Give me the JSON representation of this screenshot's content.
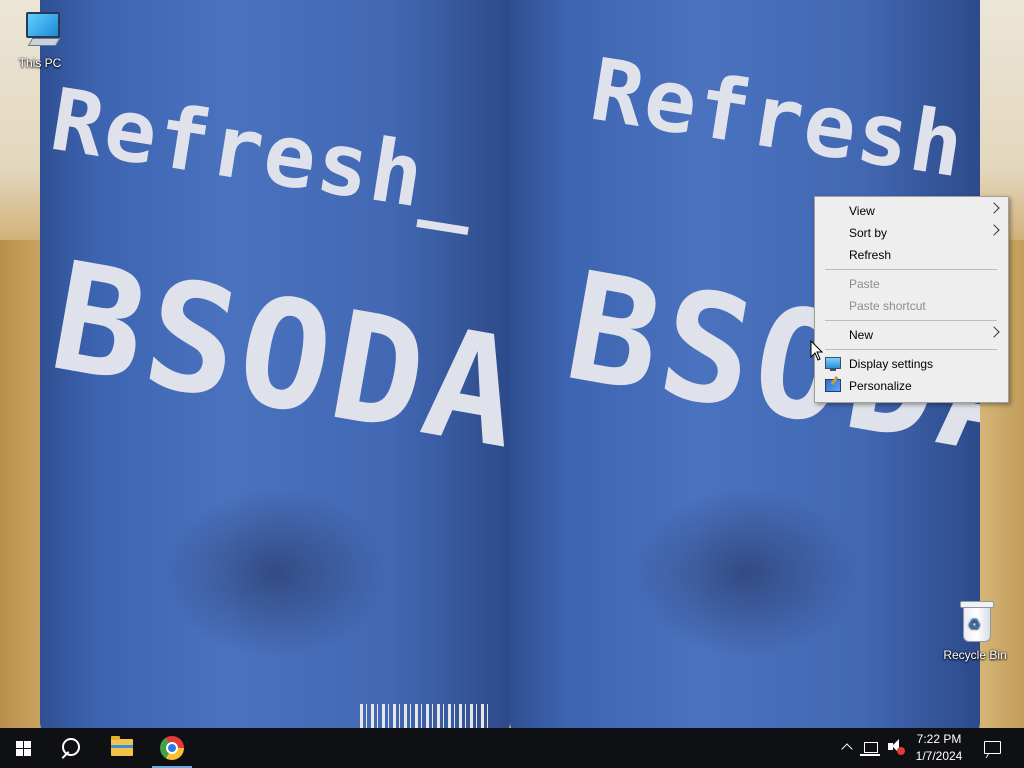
{
  "desktop": {
    "icons": [
      {
        "label": "This PC",
        "icon": "this-pc-icon"
      },
      {
        "label": "Recycle Bin",
        "icon": "recycle-bin-icon"
      }
    ],
    "wallpaper_text": {
      "left_can": [
        "Refresh_",
        "BSODA!"
      ],
      "right_can": [
        "Refresh",
        "BSODA"
      ]
    }
  },
  "context_menu": {
    "items": [
      {
        "label": "View",
        "submenu": true,
        "enabled": true
      },
      {
        "label": "Sort by",
        "submenu": true,
        "enabled": true
      },
      {
        "label": "Refresh",
        "submenu": false,
        "enabled": true
      },
      {
        "label": "Paste",
        "submenu": false,
        "enabled": false
      },
      {
        "label": "Paste shortcut",
        "submenu": false,
        "enabled": false
      },
      {
        "label": "New",
        "submenu": true,
        "enabled": true
      },
      {
        "label": "Display settings",
        "submenu": false,
        "enabled": true,
        "icon": "display-settings-icon"
      },
      {
        "label": "Personalize",
        "submenu": false,
        "enabled": true,
        "icon": "personalize-icon"
      }
    ]
  },
  "taskbar": {
    "pinned": [
      {
        "name": "start",
        "icon": "windows-logo-icon"
      },
      {
        "name": "search",
        "icon": "search-icon"
      },
      {
        "name": "file-explorer",
        "icon": "folder-icon"
      },
      {
        "name": "chrome",
        "icon": "chrome-icon",
        "active": true
      }
    ],
    "tray": {
      "icons": [
        "chevron-up-icon",
        "network-icon",
        "volume-muted-icon"
      ],
      "time": "7:22 PM",
      "date": "1/7/2024"
    }
  },
  "colors": {
    "taskbar_bg": "#0f1014",
    "menu_bg": "#eeeeee",
    "disabled_text": "#8d8d8d",
    "active_indicator": "#6aa9e6"
  }
}
